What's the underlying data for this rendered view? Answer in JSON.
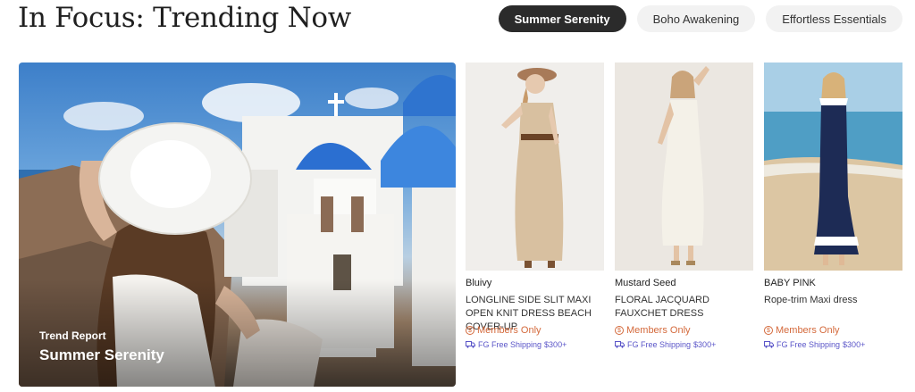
{
  "header": {
    "title": "In Focus: Trending Now"
  },
  "tabs": [
    {
      "label": "Summer Serenity",
      "active": true
    },
    {
      "label": "Boho Awakening",
      "active": false
    },
    {
      "label": "Effortless Essentials",
      "active": false
    }
  ],
  "hero": {
    "kicker": "Trend Report",
    "title": "Summer Serenity"
  },
  "products": [
    {
      "brand": "Bluivy",
      "name": "LONGLINE SIDE SLIT MAXI OPEN KNIT DRESS BEACH COVER-UP",
      "members": "Members Only",
      "shipping": "FG Free Shipping",
      "shipping_min": "$300+"
    },
    {
      "brand": "Mustard Seed",
      "name": "FLORAL JACQUARD FAUXCHET DRESS",
      "members": "Members Only",
      "shipping": "FG Free Shipping",
      "shipping_min": "$300+"
    },
    {
      "brand": "BABY PINK",
      "name": "Rope-trim Maxi dress",
      "members": "Members Only",
      "shipping": "FG Free Shipping",
      "shipping_min": "$300+"
    }
  ],
  "colors": {
    "active_tab": "#2b2b2b",
    "members": "#d46a3c",
    "shipping": "#5a55c8"
  },
  "icons": {
    "members": "dollar-coin-icon",
    "shipping": "truck-icon"
  }
}
